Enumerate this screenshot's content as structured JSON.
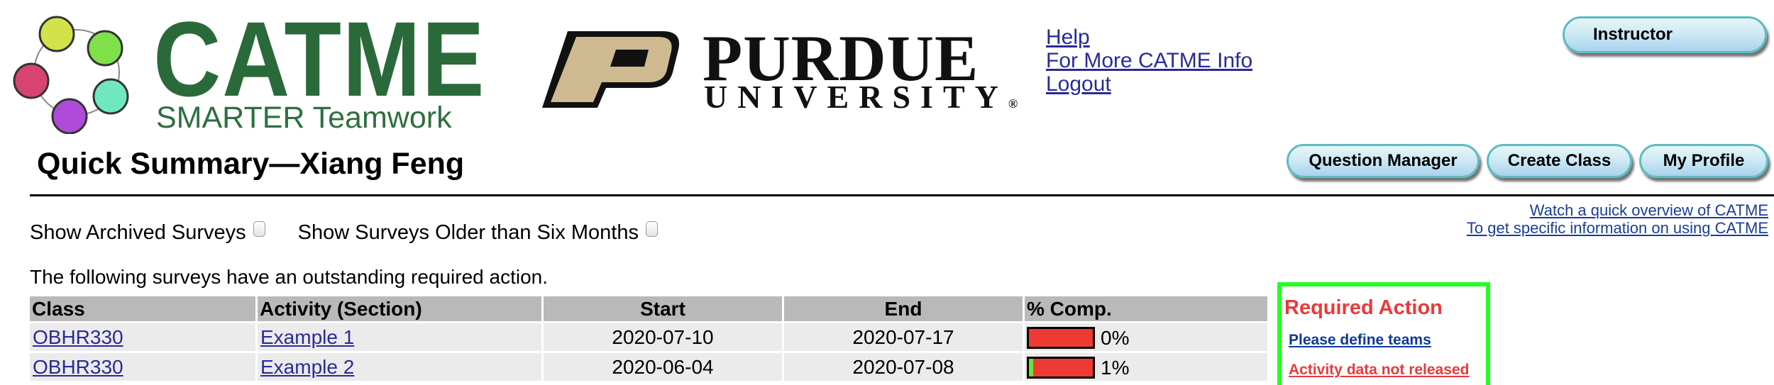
{
  "header": {
    "catme_logo": {
      "title": "CATME",
      "tagline": "SMARTER Teamwork"
    },
    "purdue_logo": {
      "name": "PURDUE",
      "sub": "UNIVERSITY",
      "mark": "®"
    },
    "links": [
      "Help",
      "For More CATME Info",
      "Logout"
    ],
    "role_button": "Instructor"
  },
  "nav_buttons": [
    "Question Manager",
    "Create Class",
    "My Profile"
  ],
  "page_title": "Quick Summary—Xiang Feng",
  "help_links": [
    "Watch a quick overview of CATME",
    "To get specific information on using CATME"
  ],
  "filters": [
    {
      "label": "Show Archived Surveys",
      "checked": false
    },
    {
      "label": "Show Surveys Older than Six Months",
      "checked": false
    }
  ],
  "notice": "The following surveys have an outstanding required action.",
  "table": {
    "columns": [
      "Class",
      "Activity (Section)",
      "Start",
      "End",
      "% Comp.",
      "Required Action"
    ],
    "rows": [
      {
        "class": "OBHR330",
        "activity": "Example 1",
        "start": "2020-07-10",
        "end": "2020-07-17",
        "completion_pct": 0,
        "completion_label": "0%",
        "required_action": "Please define teams",
        "action_type": "define-teams"
      },
      {
        "class": "OBHR330",
        "activity": "Example 2",
        "start": "2020-06-04",
        "end": "2020-07-08",
        "completion_pct": 1,
        "completion_label": "1%",
        "required_action": "Activity data not released",
        "action_type": "release-data"
      }
    ]
  },
  "colors": {
    "progress_incomplete": "#ee3a35",
    "progress_complete": "#6ae236",
    "highlight_box": "#22ff22",
    "required_action_red": "#e83a3a",
    "link_blue": "#2a2a9a"
  }
}
